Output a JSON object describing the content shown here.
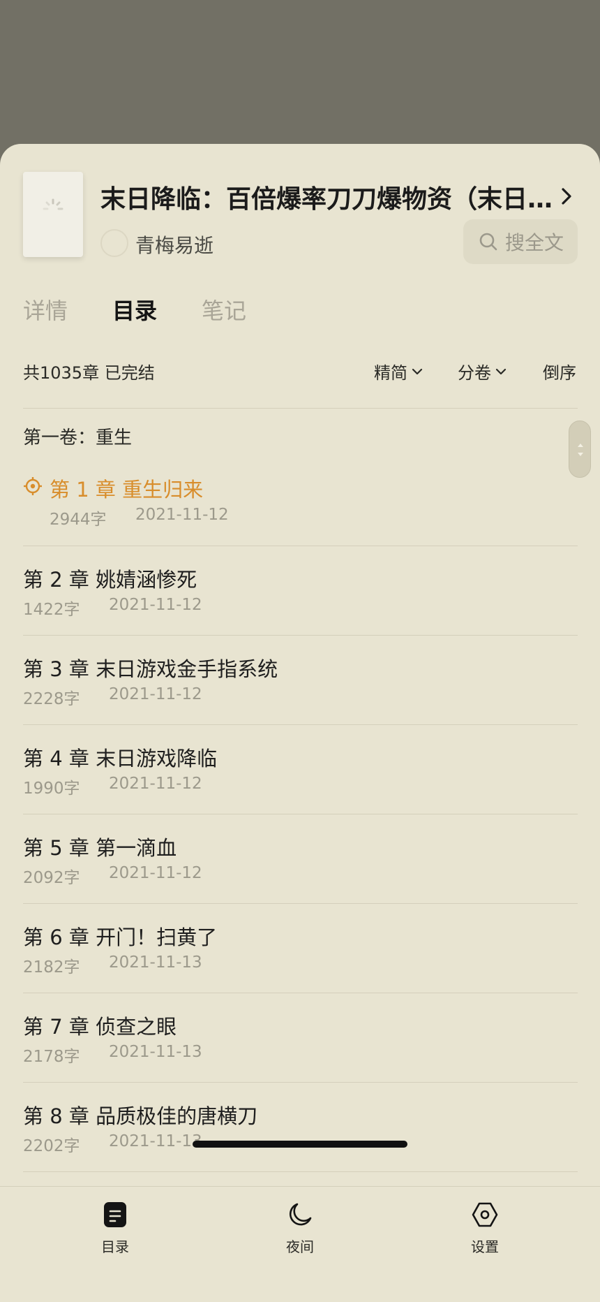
{
  "book": {
    "title": "末日降临：百倍爆率刀刀爆物资（末日…",
    "author": "青梅易逝"
  },
  "search": {
    "label": "搜全文"
  },
  "tabs": [
    {
      "label": "详情",
      "active": false
    },
    {
      "label": "目录",
      "active": true
    },
    {
      "label": "笔记",
      "active": false
    }
  ],
  "summary": {
    "text": "共1035章 已完结"
  },
  "filters": {
    "simplified": "精简",
    "volumes": "分卷",
    "reverse": "倒序"
  },
  "volume": {
    "title": "第一卷：重生"
  },
  "chapters": [
    {
      "title": "第 1 章  重生归来",
      "words": "2944字",
      "date": "2021-11-12",
      "current": true
    },
    {
      "title": "第 2 章  姚婧涵惨死",
      "words": "1422字",
      "date": "2021-11-12"
    },
    {
      "title": "第 3 章  末日游戏金手指系统",
      "words": "2228字",
      "date": "2021-11-12"
    },
    {
      "title": "第 4 章  末日游戏降临",
      "words": "1990字",
      "date": "2021-11-12"
    },
    {
      "title": "第 5 章  第一滴血",
      "words": "2092字",
      "date": "2021-11-12"
    },
    {
      "title": "第 6 章  开门！扫黄了",
      "words": "2182字",
      "date": "2021-11-13"
    },
    {
      "title": "第 7 章  侦查之眼",
      "words": "2178字",
      "date": "2021-11-13"
    },
    {
      "title": "第 8 章  品质极佳的唐横刀",
      "words": "2202字",
      "date": "2021-11-13"
    }
  ],
  "bottom_nav": [
    {
      "label": "目录",
      "icon": "toc-icon"
    },
    {
      "label": "夜间",
      "icon": "moon-icon"
    },
    {
      "label": "设置",
      "icon": "settings-icon"
    }
  ],
  "colors": {
    "backdrop": "#727065",
    "sheet": "#e8e4d1",
    "accent_current_chapter": "#d88d2b",
    "muted_text": "#9c998b"
  }
}
